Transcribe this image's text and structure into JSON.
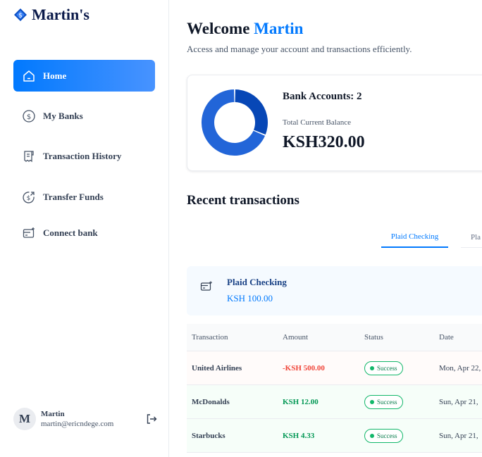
{
  "brand": {
    "name": "Martin's",
    "logo_icon": "bank-logo-icon",
    "logo_color": "#0b4fc4"
  },
  "nav": [
    {
      "label": "Home",
      "icon": "home-icon",
      "active": true
    },
    {
      "label": "My Banks",
      "icon": "dollar-circle-icon",
      "active": false
    },
    {
      "label": "Transaction History",
      "icon": "receipt-icon",
      "active": false
    },
    {
      "label": "Transfer Funds",
      "icon": "money-send-icon",
      "active": false
    },
    {
      "label": "Connect bank",
      "icon": "connect-bank-icon",
      "active": false
    }
  ],
  "user": {
    "initial": "M",
    "name": "Martin",
    "email": "martin@ericndege.com",
    "logout_icon": "logout-icon"
  },
  "header": {
    "greeting": "Welcome",
    "user_name": "Martin",
    "subtitle": "Access and manage your account and transactions efficiently."
  },
  "balance": {
    "bank_accounts": "Bank Accounts: 2",
    "total_label": "Total Current Balance",
    "total_value": "KSH320.00",
    "chart_data": {
      "type": "pie",
      "donut": true,
      "values": [
        100,
        220
      ],
      "colors": [
        "#0747b6",
        "#2265d8"
      ]
    }
  },
  "recent": {
    "title": "Recent transactions",
    "tabs": [
      {
        "label": "Plaid Checking",
        "active": true
      },
      {
        "label": "Pla",
        "active": false
      }
    ],
    "account": {
      "name": "Plaid Checking",
      "amount": "KSH 100.00",
      "icon": "card-add-icon"
    },
    "table": {
      "headers": [
        "Transaction",
        "Amount",
        "Status",
        "Date"
      ],
      "rows": [
        {
          "name": "United Airlines",
          "amount": "-KSH 500.00",
          "status": "Success",
          "date": "Mon, Apr 22,",
          "type": "debit"
        },
        {
          "name": "McDonalds",
          "amount": "KSH 12.00",
          "status": "Success",
          "date": "Sun, Apr 21,",
          "type": "credit"
        },
        {
          "name": "Starbucks",
          "amount": "KSH 4.33",
          "status": "Success",
          "date": "Sun, Apr 21,",
          "type": "credit"
        }
      ]
    }
  }
}
